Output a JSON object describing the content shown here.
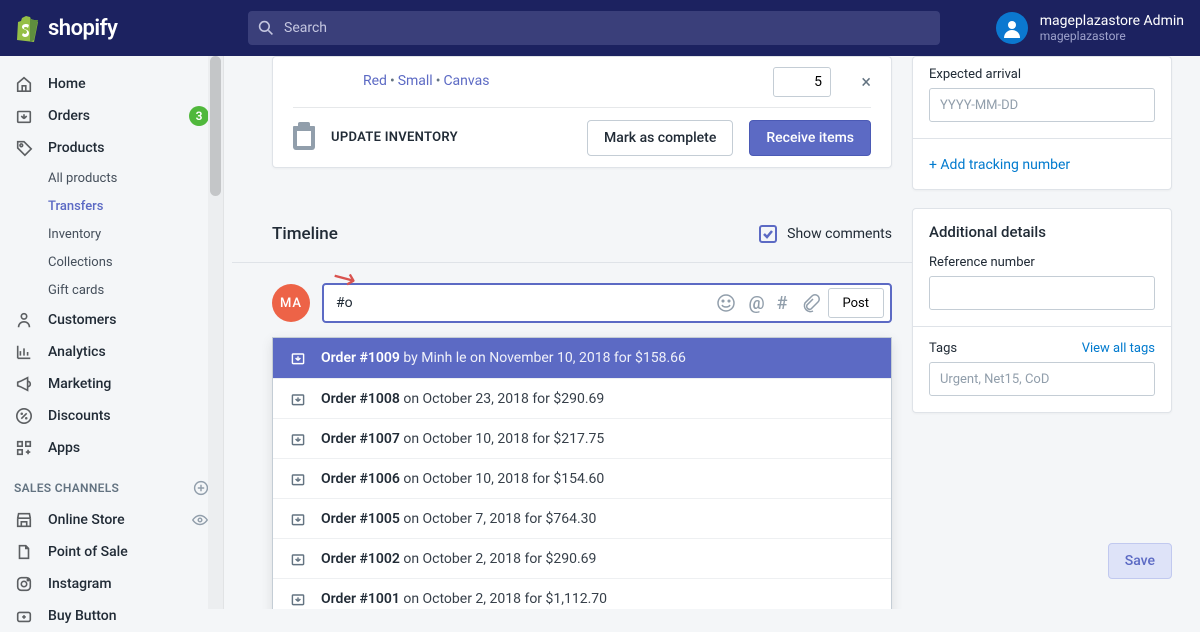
{
  "topbar": {
    "brand": "shopify",
    "search_placeholder": "Search",
    "user_name": "mageplazastore Admin",
    "store_name": "mageplazastore"
  },
  "sidebar": {
    "items": [
      {
        "icon": "home",
        "label": "Home"
      },
      {
        "icon": "orders",
        "label": "Orders",
        "badge": "3"
      },
      {
        "icon": "products",
        "label": "Products",
        "sub": [
          {
            "label": "All products"
          },
          {
            "label": "Transfers",
            "active": true
          },
          {
            "label": "Inventory"
          },
          {
            "label": "Collections"
          },
          {
            "label": "Gift cards"
          }
        ]
      },
      {
        "icon": "customers",
        "label": "Customers"
      },
      {
        "icon": "analytics",
        "label": "Analytics"
      },
      {
        "icon": "marketing",
        "label": "Marketing"
      },
      {
        "icon": "discounts",
        "label": "Discounts"
      },
      {
        "icon": "apps",
        "label": "Apps"
      }
    ],
    "section_label": "SALES CHANNELS",
    "channels": [
      {
        "icon": "store",
        "label": "Online Store",
        "eye": true
      },
      {
        "icon": "pos",
        "label": "Point of Sale"
      },
      {
        "icon": "instagram",
        "label": "Instagram"
      },
      {
        "icon": "buybutton",
        "label": "Buy Button"
      }
    ]
  },
  "product": {
    "variant_parts": [
      "Red",
      "Small",
      "Canvas"
    ],
    "qty": "5",
    "update_label": "UPDATE INVENTORY",
    "mark_complete": "Mark as complete",
    "receive_items": "Receive items"
  },
  "timeline": {
    "title": "Timeline",
    "show_comments": "Show comments",
    "avatar_initials": "MA",
    "input_value": "#o",
    "post_label": "Post"
  },
  "dropdown": [
    {
      "num": "Order #1009",
      "rest": " by Minh le on November 10, 2018 for $158.66"
    },
    {
      "num": "Order #1008",
      "rest": " on October 23, 2018 for $290.69"
    },
    {
      "num": "Order #1007",
      "rest": " on October 10, 2018 for $217.75"
    },
    {
      "num": "Order #1006",
      "rest": " on October 10, 2018 for $154.60"
    },
    {
      "num": "Order #1005",
      "rest": " on October 7, 2018 for $764.30"
    },
    {
      "num": "Order #1002",
      "rest": " on October 2, 2018 for $290.69"
    },
    {
      "num": "Order #1001",
      "rest": " on October 2, 2018 for $1,112.70"
    }
  ],
  "right": {
    "expected_label": "Expected arrival",
    "expected_placeholder": "YYYY-MM-DD",
    "add_tracking": "+ Add tracking number",
    "details_title": "Additional details",
    "reference_label": "Reference number",
    "tags_label": "Tags",
    "view_all_tags": "View all tags",
    "tags_placeholder": "Urgent, Net15, CoD",
    "save_label": "Save"
  }
}
